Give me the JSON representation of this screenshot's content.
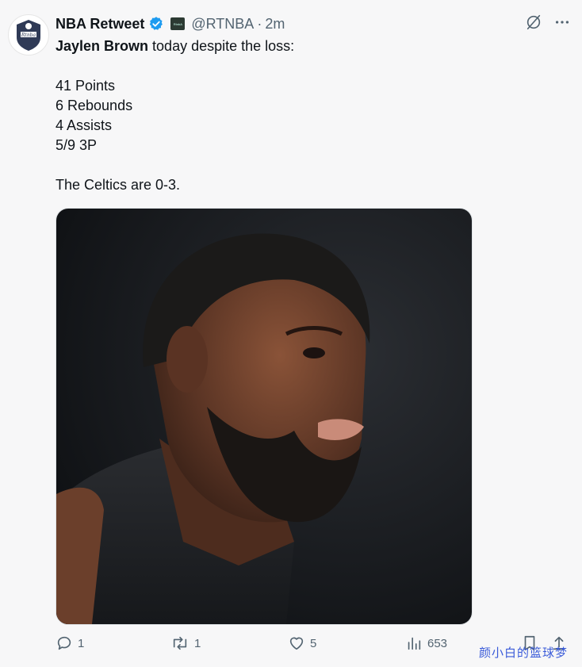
{
  "tweet": {
    "author_name": "NBA Retweet",
    "handle": "@RTNBA",
    "time_separator": "·",
    "time": "2m",
    "avatar_text": "Rtnba",
    "affiliate_badge_text": "RtnbA",
    "intro_bold": "Jaylen Brown",
    "intro_rest": " today despite the loss:",
    "stats": [
      "41 Points",
      "6 Rebounds",
      "4 Assists",
      "5/9 3P"
    ],
    "closing": "The Celtics are 0-3.",
    "actions": {
      "replies": "1",
      "retweets": "1",
      "likes": "5",
      "views": "653"
    }
  },
  "watermark": "颜小白的篮球梦",
  "colors": {
    "accent": "#1d9bf0",
    "muted": "#536471",
    "text": "#0f1419"
  }
}
